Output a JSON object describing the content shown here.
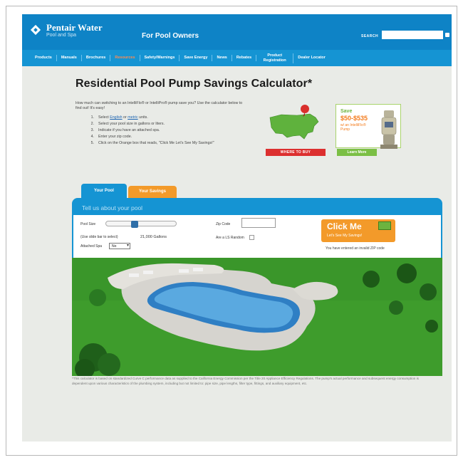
{
  "header": {
    "brand": "Pentair Water",
    "brand_sub": "Pool and Spa",
    "section": "For Pool Owners",
    "search_label": "SEARCH",
    "search_value": ""
  },
  "nav": {
    "items": [
      {
        "label": "Products",
        "active": false
      },
      {
        "label": "Manuals",
        "active": false
      },
      {
        "label": "Brochures",
        "active": false
      },
      {
        "label": "Resources",
        "active": true
      },
      {
        "label": "Safety/Warnings",
        "active": false
      },
      {
        "label": "Save Energy",
        "active": false
      },
      {
        "label": "News",
        "active": false
      },
      {
        "label": "Rebates",
        "active": false
      },
      {
        "label": "Product Registration",
        "active": false
      },
      {
        "label": "Dealer Locator",
        "active": false
      }
    ]
  },
  "page": {
    "title": "Residential Pool Pump Savings Calculator*",
    "intro": "How much can switching to an IntelliFlo® or IntelliPro® pump save you? Use the calculator below to find out! It's easy!",
    "steps": [
      {
        "num": "1.",
        "pre": "Select ",
        "link1": "English",
        "mid": " or ",
        "link2": "metric",
        "post": " units."
      },
      {
        "num": "2.",
        "text": "Select your pool size in gallons or liters."
      },
      {
        "num": "3.",
        "text": "Indicate if you have an attached spa."
      },
      {
        "num": "4.",
        "text": "Enter your zip code."
      },
      {
        "num": "5.",
        "text": "Click on the Orange box that reads, \"Click Me Let's See My Savings!\""
      }
    ]
  },
  "promos": {
    "map_button": "WHERE TO BUY",
    "save_title": "Save",
    "save_amount": "$50-$535",
    "save_desc": "w/ an IntelliFlo® Pump",
    "learn_button": "Learn More"
  },
  "tabs": [
    {
      "label": "Your Pool",
      "active": true
    },
    {
      "label": "Your Savings",
      "active": false
    }
  ],
  "calculator": {
    "heading": "Tell us about your pool",
    "pool_size_label": "Pool Size",
    "slider_value": 0.4,
    "size_hint_label": "(Use slide bar to select)",
    "gallons_value": "21,000 Gallons",
    "spa_label": "Attached Spa",
    "spa_value": "No",
    "zip_label": "Zip Code",
    "zip_value": "",
    "clean_label": "Are a LS Random",
    "click_big": "Click Me",
    "click_small": "Let's See My Savings!",
    "notice": "You have entered an invalid ZIP code"
  },
  "disclaimer": "*This calculator is based on standardized Curve C performance data as supplied to the California Energy Commission per the Title 20 Appliance Efficiency Regulations. The pump's actual performance and subsequent energy consumption is dependent upon various characteristics of the plumbing system, including but not limited to: pipe size, pipe lengths, filter type, fittings, and auxiliary equipment, etc.",
  "colors": {
    "brand_blue": "#0e83c6",
    "nav_blue": "#1594d3",
    "accent_orange": "#f39a2a",
    "accent_green": "#6db33f",
    "alert_red": "#dc2f2f"
  }
}
